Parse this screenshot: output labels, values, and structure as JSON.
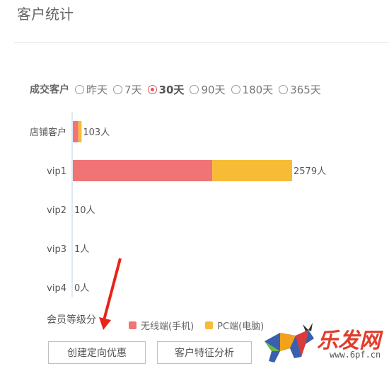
{
  "page_title": "客户统计",
  "filter": {
    "label": "成交客户",
    "options": [
      "昨天",
      "7天",
      "30天",
      "90天",
      "180天",
      "365天"
    ],
    "selected": "30天"
  },
  "chart_data": {
    "type": "bar",
    "orientation": "horizontal",
    "stacked": true,
    "categories": [
      "店铺客户",
      "vip1",
      "vip2",
      "vip3",
      "vip4"
    ],
    "totals_labels": [
      "103人",
      "2579人",
      "10人",
      "1人",
      "0人"
    ],
    "series": [
      {
        "name": "无线端(手机)",
        "color": "#f07476",
        "values": [
          64,
          1640,
          0,
          0,
          0
        ]
      },
      {
        "name": "PC端(电脑)",
        "color": "#f7bb36",
        "values": [
          39,
          939,
          0,
          0,
          0
        ]
      }
    ],
    "xlim": [
      0,
      3000
    ],
    "ylabel": "会员等级分"
  },
  "buttons": {
    "create_offer": "创建定向优惠",
    "analysis": "客户特征分析"
  },
  "logo": {
    "text": "乐发网",
    "url": "www.6pf.cn"
  },
  "colors": {
    "accent": "#e9545a"
  }
}
